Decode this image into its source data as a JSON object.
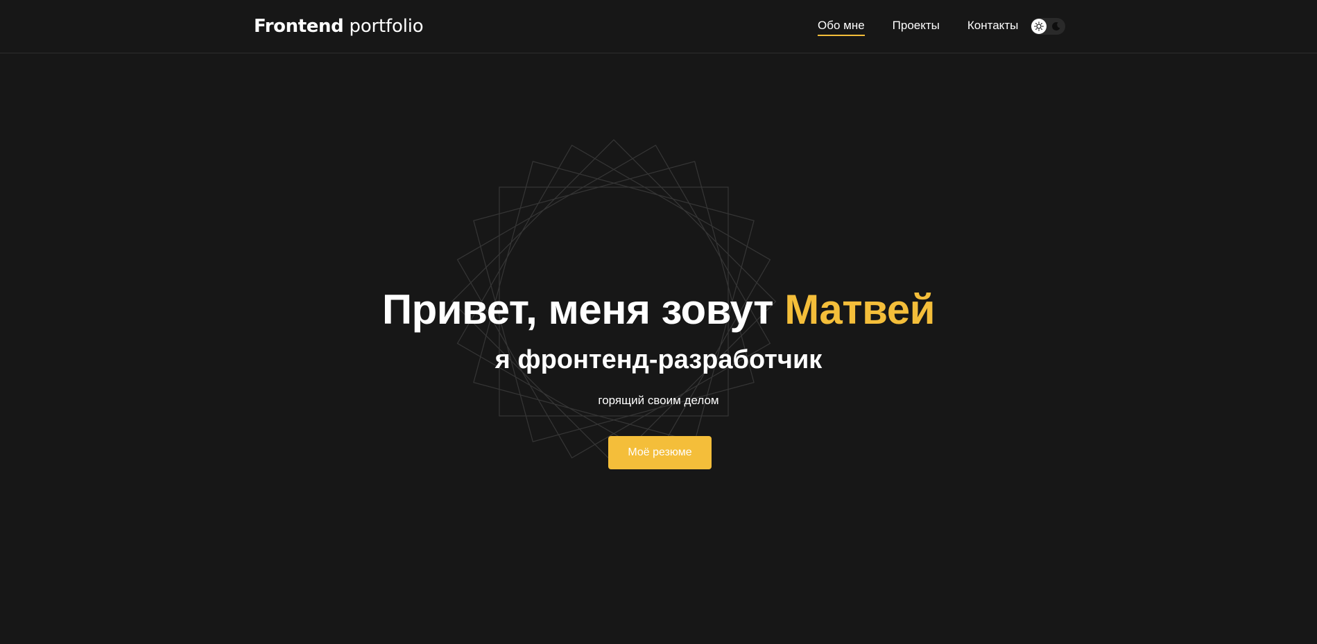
{
  "header": {
    "logo_bold": "Frontend",
    "logo_light": "portfolio",
    "nav": [
      {
        "label": "Обо мне",
        "active": true
      },
      {
        "label": "Проекты",
        "active": false
      },
      {
        "label": "Контакты",
        "active": false
      }
    ],
    "theme_toggle": {
      "current": "light",
      "icons": [
        "sun-icon",
        "moon-icon"
      ]
    }
  },
  "hero": {
    "title_prefix": "Привет, меня зовут",
    "title_name": "Матвей",
    "subtitle": "я фронтенд-разработчик",
    "tagline": "горящий своим делом",
    "cta_label": "Моё резюме"
  },
  "colors": {
    "background": "#171717",
    "accent": "#f4be3a",
    "text": "#ffffff",
    "divider": "#2e2e2e"
  }
}
